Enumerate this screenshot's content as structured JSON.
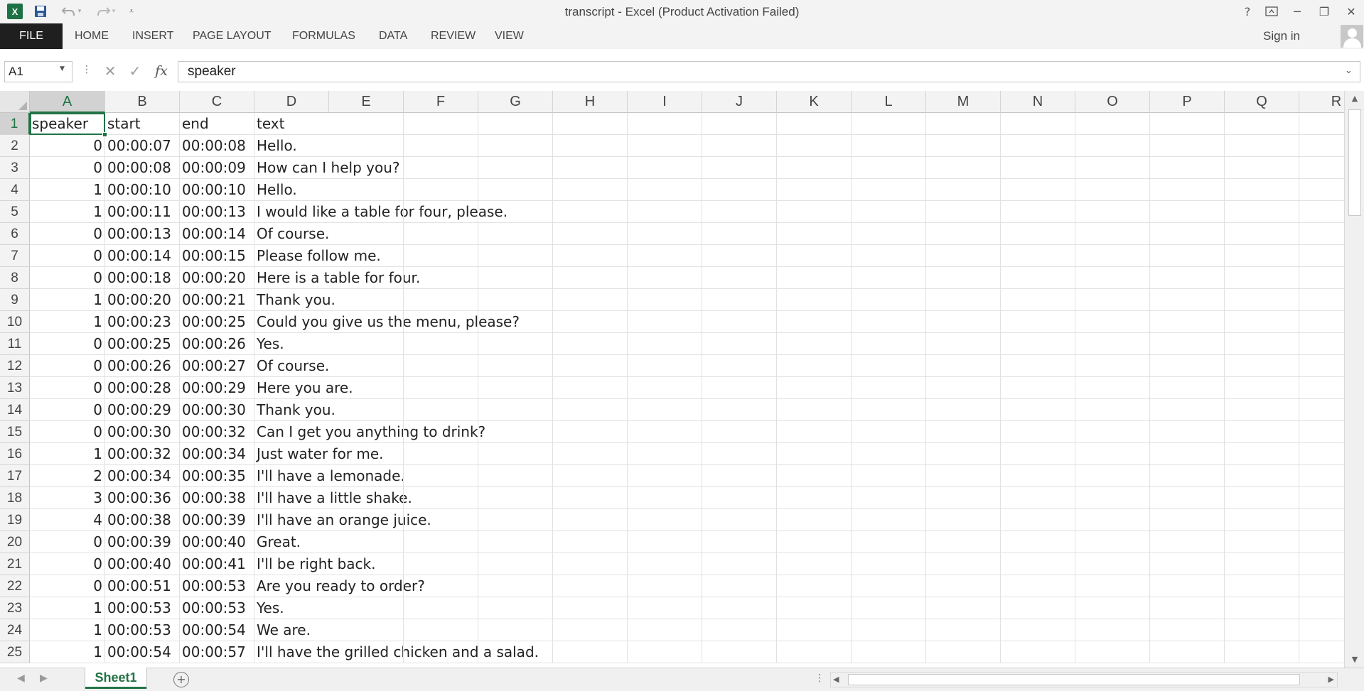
{
  "window": {
    "title": "transcript - Excel (Product Activation Failed)"
  },
  "quick_access": {
    "logo_letter": "X",
    "icons": [
      "excel-logo-icon",
      "save-icon",
      "undo-icon",
      "redo-icon",
      "customize-chevron-icon"
    ]
  },
  "window_controls": {
    "help": "?",
    "minimize": "─",
    "maximize": "❐",
    "close": "✕"
  },
  "ribbon": {
    "file_label": "FILE",
    "tabs": [
      "HOME",
      "INSERT",
      "PAGE LAYOUT",
      "FORMULAS",
      "DATA",
      "REVIEW",
      "VIEW"
    ],
    "sign_in": "Sign in"
  },
  "formula_bar": {
    "name_box": "A1",
    "fx_label": "fx",
    "value": "speaker"
  },
  "grid": {
    "columns": [
      "A",
      "B",
      "C",
      "D",
      "E",
      "F",
      "G",
      "H",
      "I",
      "J",
      "K",
      "L",
      "M",
      "N",
      "O",
      "P",
      "Q",
      "R"
    ],
    "rows": [
      [
        "speaker",
        "start",
        "end",
        "text"
      ],
      [
        "0",
        "00:00:07",
        "00:00:08",
        "Hello."
      ],
      [
        "0",
        "00:00:08",
        "00:00:09",
        "How can I help you?"
      ],
      [
        "1",
        "00:00:10",
        "00:00:10",
        "Hello."
      ],
      [
        "1",
        "00:00:11",
        "00:00:13",
        "I would like a table for four, please."
      ],
      [
        "0",
        "00:00:13",
        "00:00:14",
        "Of course."
      ],
      [
        "0",
        "00:00:14",
        "00:00:15",
        "Please follow me."
      ],
      [
        "0",
        "00:00:18",
        "00:00:20",
        "Here is a table for four."
      ],
      [
        "1",
        "00:00:20",
        "00:00:21",
        "Thank you."
      ],
      [
        "1",
        "00:00:23",
        "00:00:25",
        "Could you give us the menu, please?"
      ],
      [
        "0",
        "00:00:25",
        "00:00:26",
        "Yes."
      ],
      [
        "0",
        "00:00:26",
        "00:00:27",
        "Of course."
      ],
      [
        "0",
        "00:00:28",
        "00:00:29",
        "Here you are."
      ],
      [
        "0",
        "00:00:29",
        "00:00:30",
        "Thank you."
      ],
      [
        "0",
        "00:00:30",
        "00:00:32",
        "Can I get you anything to drink?"
      ],
      [
        "1",
        "00:00:32",
        "00:00:34",
        "Just water for me."
      ],
      [
        "2",
        "00:00:34",
        "00:00:35",
        "I'll have a lemonade."
      ],
      [
        "3",
        "00:00:36",
        "00:00:38",
        "I'll have a little shake."
      ],
      [
        "4",
        "00:00:38",
        "00:00:39",
        "I'll have an orange juice."
      ],
      [
        "0",
        "00:00:39",
        "00:00:40",
        "Great."
      ],
      [
        "0",
        "00:00:40",
        "00:00:41",
        "I'll be right back."
      ],
      [
        "0",
        "00:00:51",
        "00:00:53",
        "Are you ready to order?"
      ],
      [
        "1",
        "00:00:53",
        "00:00:53",
        "Yes."
      ],
      [
        "1",
        "00:00:53",
        "00:00:54",
        "We are."
      ],
      [
        "1",
        "00:00:54",
        "00:00:57",
        "I'll have the grilled chicken and a salad."
      ]
    ],
    "selected_cell": "A1",
    "accent_color": "#217346"
  },
  "sheets": {
    "tabs": [
      "Sheet1"
    ],
    "active": "Sheet1",
    "new_sheet_symbol": "+"
  }
}
